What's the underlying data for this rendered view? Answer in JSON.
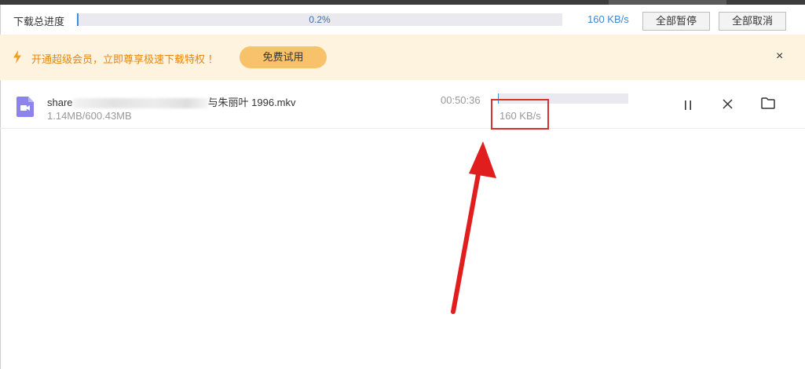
{
  "header": {
    "label": "下载总进度",
    "percent_text": "0.2%",
    "progress": 0.002,
    "speed": "160 KB/s",
    "pause_all": "全部暂停",
    "cancel_all": "全部取消"
  },
  "promo": {
    "icon": "lightning-icon",
    "text": "开通超级会员，立即尊享极速下载特权 ！",
    "trial_button": "免费试用",
    "close": "×"
  },
  "task": {
    "name_prefix": "share",
    "name_suffix": "与朱丽叶 1996.mkv",
    "size": "1.14MB/600.43MB",
    "remaining": "00:50:36",
    "speed": "160 KB/s",
    "progress": 0.002,
    "icons": [
      "video-file-icon",
      "pause-icon",
      "close-icon",
      "folder-icon"
    ]
  },
  "annotation": {
    "box_color": "#d9302a",
    "arrow_color": "#e01e1e"
  },
  "colors": {
    "accent": "#3b87d8",
    "promo_bg": "#fdf3df",
    "promo_text": "#e8860e",
    "trial_bg": "#f7c26a",
    "file_icon": "#8c83ee"
  }
}
